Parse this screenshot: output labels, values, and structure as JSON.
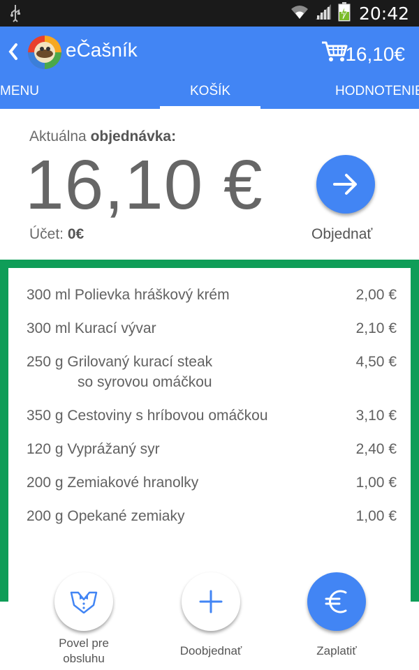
{
  "status_bar": {
    "time": "20:42",
    "icons": [
      "usb-icon",
      "wifi-icon",
      "signal-icon",
      "battery-charging-icon"
    ]
  },
  "app_bar": {
    "title": "eČašník",
    "cart_total": "16,10€",
    "tabs": [
      {
        "label": "MENU"
      },
      {
        "label": "KOŠÍK",
        "active": true
      },
      {
        "label": "HODNOTENIE"
      }
    ]
  },
  "order": {
    "label_prefix": "Aktuálna ",
    "label_bold": "objednávka:",
    "total": "16,10 €",
    "account_prefix": "Účet: ",
    "account_value": "0€",
    "order_button_label": "Objednať"
  },
  "items": [
    {
      "name": "300 ml Polievka hráškový krém",
      "price": "2,00 €"
    },
    {
      "name": "300 ml Kurací vývar",
      "price": "2,10 €"
    },
    {
      "name": "250 g Grilovaný kurací steak",
      "name2": "so syrovou omáčkou",
      "price": "4,50 €"
    },
    {
      "name": "350 g Cestoviny s hríbovou omáčkou",
      "price": "3,10 €"
    },
    {
      "name": "120 g Vyprážaný syr",
      "price": "2,40 €"
    },
    {
      "name": "200 g Zemiakové hranolky",
      "price": "1,00 €"
    },
    {
      "name": "200 g Opekané zemiaky",
      "price": "1,00 €"
    }
  ],
  "bottom_actions": {
    "call_staff_line1": "Povel pre",
    "call_staff_line2": "obsluhu",
    "add_more": "Doobjednať",
    "pay": "Zaplatiť"
  },
  "colors": {
    "primary": "#4285f4",
    "green": "#0f9d58",
    "text": "#616161"
  }
}
